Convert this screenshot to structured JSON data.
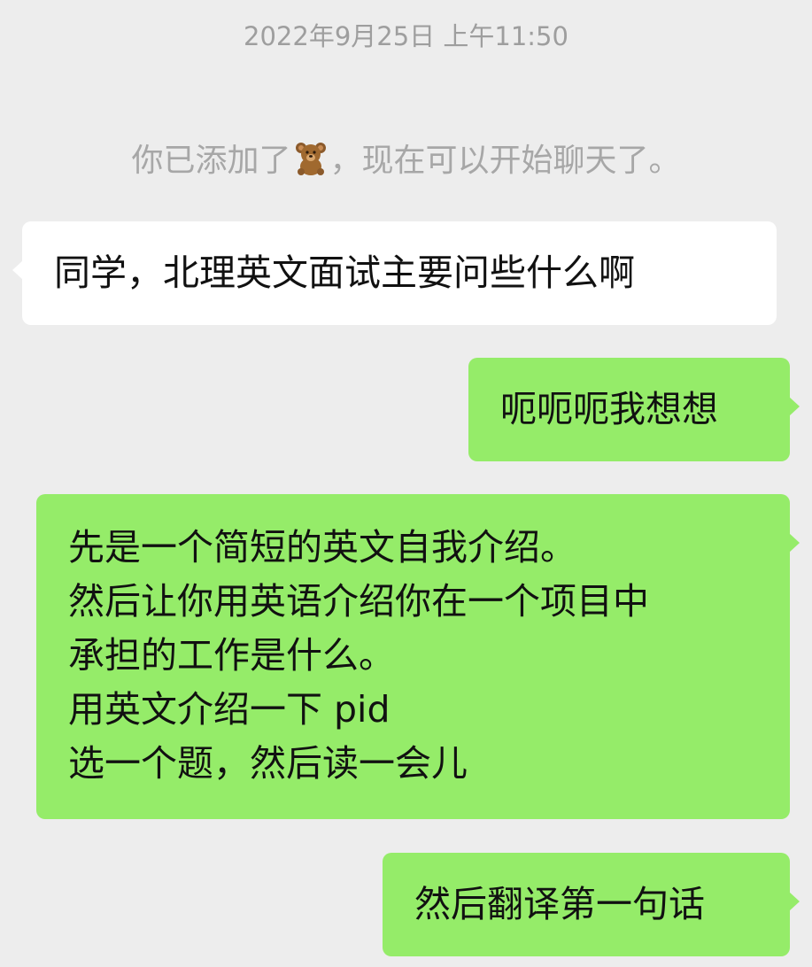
{
  "timestamp": "2022年9月25日 上午11:50",
  "system_notice": {
    "prefix": "你已添加了",
    "contact_icon": "teddy-bear-emoji",
    "suffix": "，现在可以开始聊天了。"
  },
  "messages": [
    {
      "side": "incoming",
      "lines": [
        "同学，北理英文面试主要问些什么啊"
      ]
    },
    {
      "side": "outgoing",
      "lines": [
        "呃呃呃我想想"
      ]
    },
    {
      "side": "outgoing",
      "lines": [
        "先是一个简短的英文自我介绍。",
        "然后让你用英语介绍你在一个项目中",
        "承担的工作是什么。",
        "用英文介绍一下 pid",
        "选一个题，然后读一会儿"
      ]
    },
    {
      "side": "outgoing",
      "lines": [
        "然后翻译第一句话"
      ]
    }
  ],
  "colors": {
    "background": "#ededed",
    "incoming_bubble": "#ffffff",
    "outgoing_bubble": "#95ec69"
  }
}
